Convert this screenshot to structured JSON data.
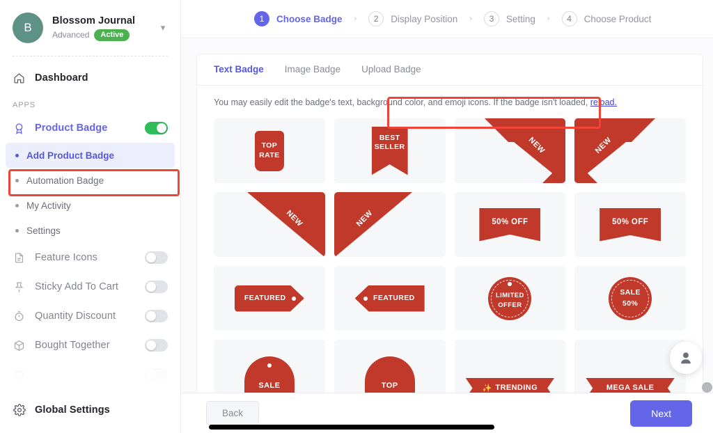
{
  "sidebar": {
    "store": {
      "initial": "B",
      "name": "Blossom Journal",
      "plan": "Advanced",
      "status": "Active",
      "chevron_icon": "chevron-down-icon"
    },
    "dashboard_label": "Dashboard",
    "section_label": "APPS",
    "apps": [
      {
        "label": "Product Badge",
        "icon": "badge-icon",
        "toggle": "on",
        "accent": true
      },
      {
        "label": "Feature Icons",
        "icon": "document-icon",
        "toggle": "off",
        "accent": false
      },
      {
        "label": "Sticky Add To Cart",
        "icon": "pin-icon",
        "toggle": "off",
        "accent": false
      },
      {
        "label": "Quantity Discount",
        "icon": "timer-icon",
        "toggle": "off",
        "accent": false
      },
      {
        "label": "Bought Together",
        "icon": "box-icon",
        "toggle": "off",
        "accent": false
      }
    ],
    "sub_items": [
      {
        "label": "Add Product Badge",
        "selected": true
      },
      {
        "label": "Automation Badge",
        "selected": false
      },
      {
        "label": "My Activity",
        "selected": false
      },
      {
        "label": "Settings",
        "selected": false
      }
    ],
    "global_settings_label": "Global Settings",
    "highlight_color": "#f04438"
  },
  "stepper": {
    "steps": [
      {
        "num": "1",
        "label": "Choose Badge",
        "active": true
      },
      {
        "num": "2",
        "label": "Display Position",
        "active": false
      },
      {
        "num": "3",
        "label": "Setting",
        "active": false
      },
      {
        "num": "4",
        "label": "Choose Product",
        "active": false
      }
    ],
    "separator": "›",
    "accent_color": "#6366e8"
  },
  "card": {
    "tabs": [
      {
        "label": "Text Badge",
        "active": true
      },
      {
        "label": "Image Badge",
        "active": false
      },
      {
        "label": "Upload Badge",
        "active": false
      }
    ],
    "hint_text": "You may easily edit the badge's text, background color, and emoji icons. If the badge isn't loaded, ",
    "hint_link": "reload.",
    "badge_color": "#c0392b",
    "badges": [
      {
        "id": "top-rate",
        "shape": "roundrect",
        "line1": "TOP",
        "line2": "RATE"
      },
      {
        "id": "best-seller",
        "shape": "ribbon",
        "line1": "BEST",
        "line2": "SELLER"
      },
      {
        "id": "new-corner-tr",
        "shape": "corner-tr",
        "line1": "NEW",
        "line2": ""
      },
      {
        "id": "new-corner-tl",
        "shape": "corner-tl",
        "line1": "NEW",
        "line2": ""
      },
      {
        "id": "new-triangle-tr",
        "shape": "triangle-tr",
        "line1": "NEW",
        "line2": ""
      },
      {
        "id": "new-triangle-tl",
        "shape": "triangle-tl",
        "line1": "NEW",
        "line2": ""
      },
      {
        "id": "fifty-off-a",
        "shape": "notch",
        "line1": "50% OFF",
        "line2": ""
      },
      {
        "id": "fifty-off-b",
        "shape": "notch2",
        "line1": "50% OFF",
        "line2": ""
      },
      {
        "id": "featured-right",
        "shape": "tag-right",
        "line1": "FEATURED",
        "line2": ""
      },
      {
        "id": "featured-left",
        "shape": "tag-left",
        "line1": "FEATURED",
        "line2": ""
      },
      {
        "id": "limited-offer",
        "shape": "circle-dot",
        "line1": "LIMITED",
        "line2": "OFFER"
      },
      {
        "id": "sale-fifty",
        "shape": "circle",
        "line1": "SALE",
        "line2": "50%"
      },
      {
        "id": "sale-dome",
        "shape": "dome-dot",
        "line1": "SALE",
        "line2": ""
      },
      {
        "id": "top-dome",
        "shape": "dome",
        "line1": "TOP",
        "line2": ""
      },
      {
        "id": "trending",
        "shape": "banner-emoji",
        "line1": "TRENDING",
        "line2": "",
        "emoji": "✨"
      },
      {
        "id": "mega-sale",
        "shape": "banner",
        "line1": "MEGA SALE",
        "line2": ""
      }
    ]
  },
  "footer": {
    "back_label": "Back",
    "next_label": "Next",
    "next_color": "#6366e8"
  },
  "support": {
    "icon": "person-icon"
  }
}
